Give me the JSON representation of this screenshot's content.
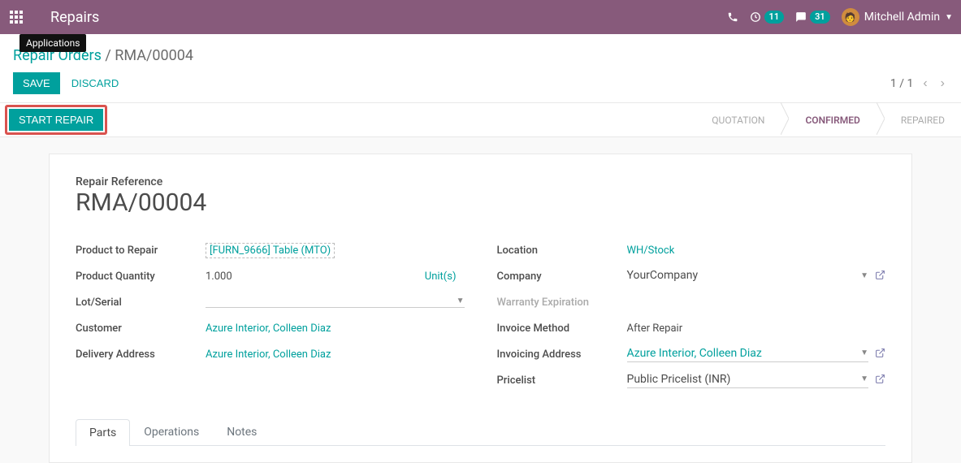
{
  "topbar": {
    "title": "Repairs",
    "tooltip": "Applications",
    "activities_count": "11",
    "messages_count": "31",
    "user_name": "Mitchell Admin"
  },
  "breadcrumb": {
    "root": "Repair Orders",
    "current": "RMA/00004"
  },
  "buttons": {
    "save": "SAVE",
    "discard": "DISCARD",
    "start_repair": "START REPAIR"
  },
  "pager": {
    "text": "1 / 1"
  },
  "status": {
    "quotation": "QUOTATION",
    "confirmed": "CONFIRMED",
    "repaired": "REPAIRED"
  },
  "form": {
    "ref_label": "Repair Reference",
    "ref_value": "RMA/00004",
    "left": {
      "product_label": "Product to Repair",
      "product_value": "[FURN_9666] Table (MTO)",
      "qty_label": "Product Quantity",
      "qty_value": "1.000",
      "qty_unit": "Unit(s)",
      "lot_label": "Lot/Serial",
      "customer_label": "Customer",
      "customer_value": "Azure Interior, Colleen Diaz",
      "delivery_label": "Delivery Address",
      "delivery_value": "Azure Interior, Colleen Diaz"
    },
    "right": {
      "location_label": "Location",
      "location_value": "WH/Stock",
      "company_label": "Company",
      "company_value": "YourCompany",
      "warranty_label": "Warranty Expiration",
      "invoice_method_label": "Invoice Method",
      "invoice_method_value": "After Repair",
      "invoicing_addr_label": "Invoicing Address",
      "invoicing_addr_value": "Azure Interior, Colleen Diaz",
      "pricelist_label": "Pricelist",
      "pricelist_value": "Public Pricelist (INR)"
    }
  },
  "tabs": {
    "parts": "Parts",
    "operations": "Operations",
    "notes": "Notes"
  }
}
